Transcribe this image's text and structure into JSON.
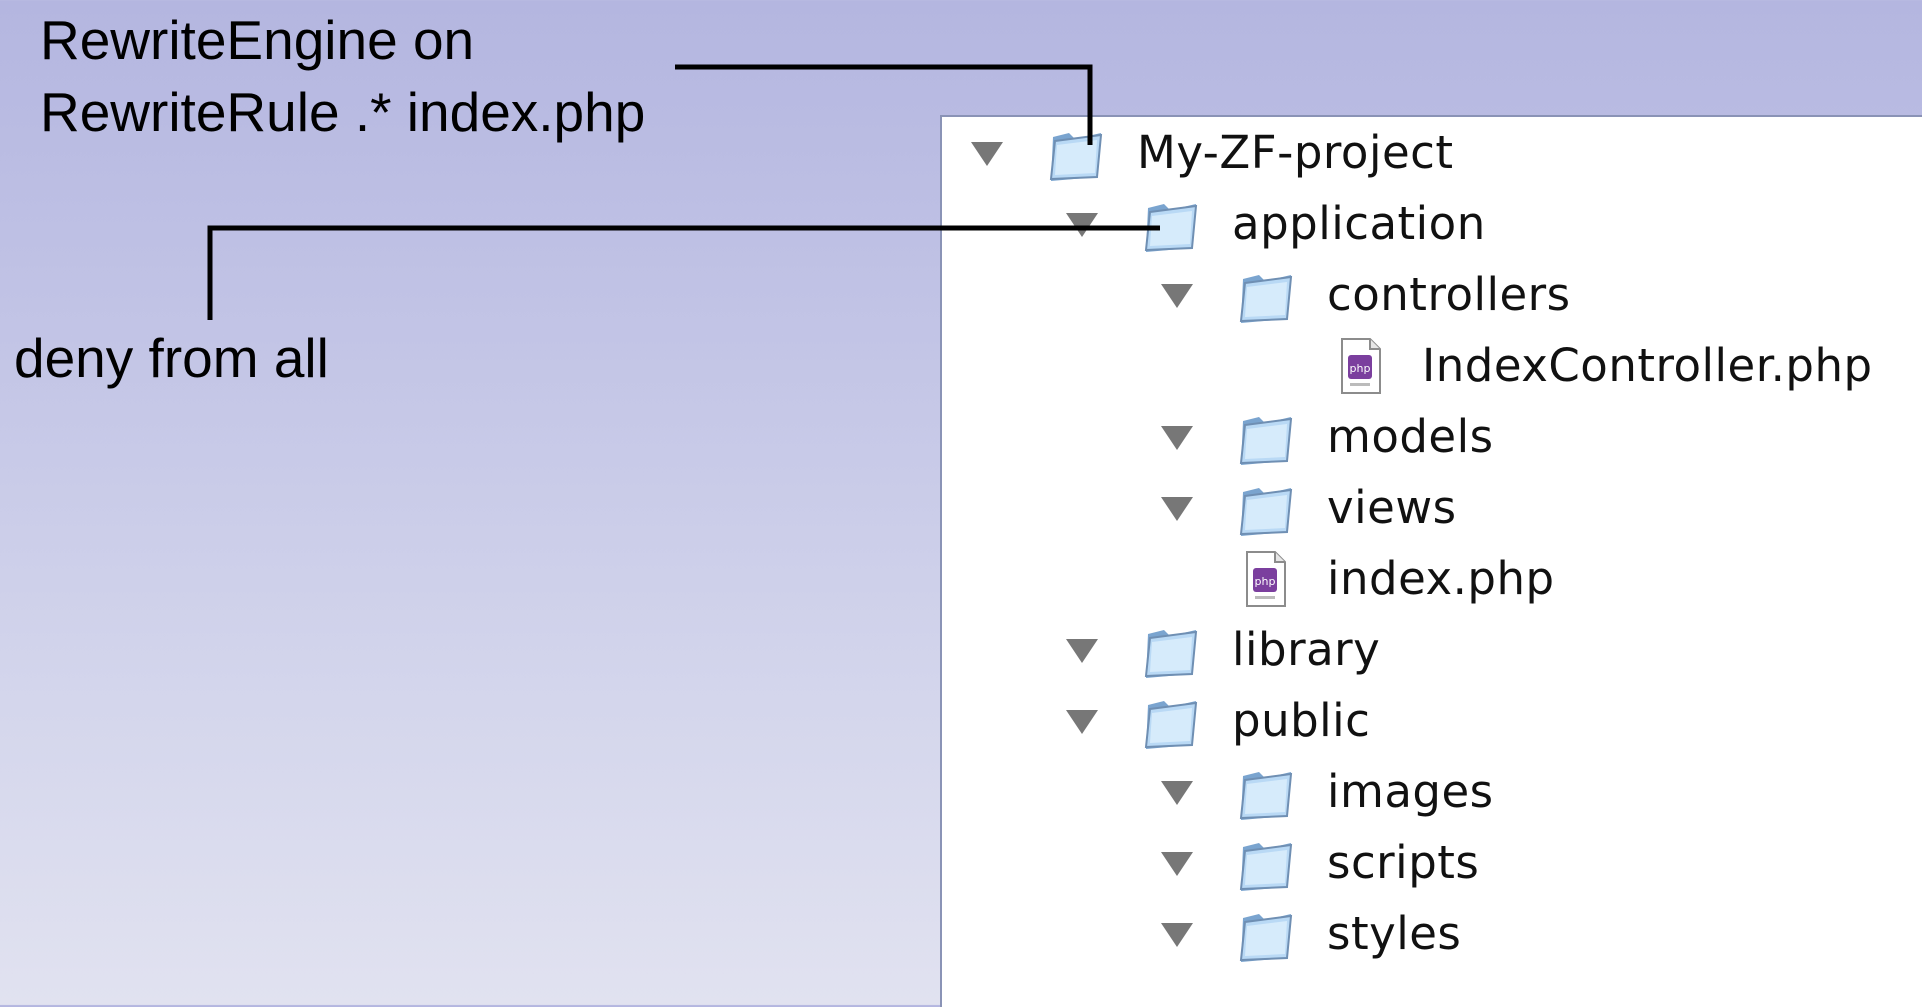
{
  "annotations": {
    "rewrite_line_1": "RewriteEngine on",
    "rewrite_line_2": "RewriteRule .* index.php",
    "deny": "deny from all"
  },
  "tree": {
    "items": [
      {
        "label": "My-ZF-project",
        "icon": "folder-icon",
        "expanded": true
      },
      {
        "label": "application",
        "icon": "folder-icon",
        "expanded": true
      },
      {
        "label": "controllers",
        "icon": "folder-icon",
        "expanded": true
      },
      {
        "label": "IndexController.php",
        "icon": "php-file-icon"
      },
      {
        "label": "models",
        "icon": "folder-icon",
        "expanded": true
      },
      {
        "label": "views",
        "icon": "folder-icon",
        "expanded": true
      },
      {
        "label": "index.php",
        "icon": "php-file-icon"
      },
      {
        "label": "library",
        "icon": "folder-icon",
        "expanded": true
      },
      {
        "label": "public",
        "icon": "folder-icon",
        "expanded": true
      },
      {
        "label": "images",
        "icon": "folder-icon",
        "expanded": true
      },
      {
        "label": "scripts",
        "icon": "folder-icon",
        "expanded": true
      },
      {
        "label": "styles",
        "icon": "folder-icon",
        "expanded": true
      }
    ]
  },
  "colors": {
    "background_top": "#b4b6e0",
    "background_bottom": "#e1e2f0",
    "panel": "#ffffff",
    "disclosure_triangle": "#777777",
    "folder_fill": "#a9cdf0",
    "php_badge": "#7b3f9e"
  }
}
